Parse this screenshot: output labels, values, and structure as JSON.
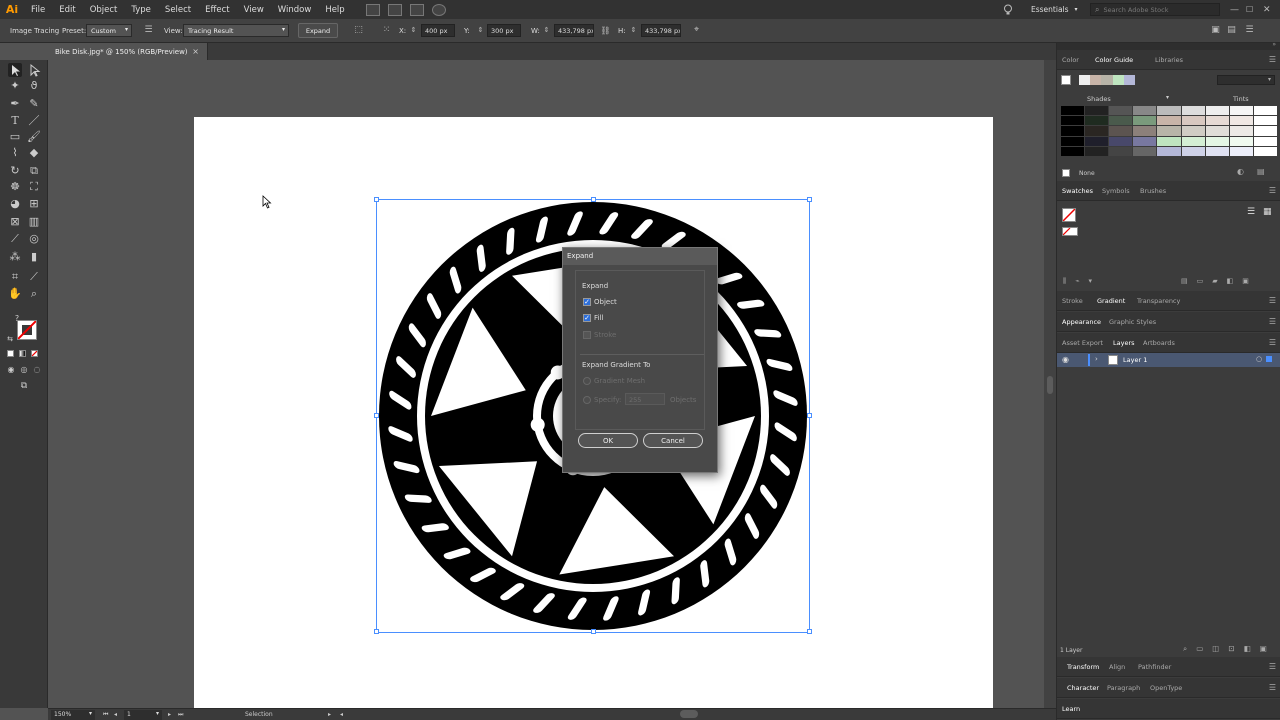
{
  "app": {
    "logo": "Ai",
    "menus": [
      "File",
      "Edit",
      "Object",
      "Type",
      "Select",
      "Effect",
      "View",
      "Window",
      "Help"
    ],
    "workspace": "Essentials",
    "stock_placeholder": "Search Adobe Stock"
  },
  "control_bar": {
    "mode_label": "Image Tracing",
    "preset_label": "Preset:",
    "preset_value": "Custom",
    "view_label": "View:",
    "view_value": "Tracing Result",
    "expand_button": "Expand",
    "x_label": "X:",
    "x_value": "400 px",
    "y_label": "Y:",
    "y_value": "300 px",
    "w_label": "W:",
    "w_value": "433,798 px",
    "h_label": "H:",
    "h_value": "433,798 px"
  },
  "document": {
    "tab_title": "Bike Disk.jpg* @ 150% (RGB/Preview)"
  },
  "status_bar": {
    "zoom": "150%",
    "artboard": "1",
    "tool": "Selection"
  },
  "dialog": {
    "title": "Expand",
    "section_expand": "Expand",
    "object_label": "Object",
    "object_checked": true,
    "fill_label": "Fill",
    "fill_checked": true,
    "stroke_label": "Stroke",
    "stroke_checked": false,
    "section_gradient": "Expand Gradient To",
    "gradient_mesh_label": "Gradient Mesh",
    "specify_label": "Specify:",
    "specify_value": "255",
    "objects_label": "Objects",
    "ok_button": "OK",
    "cancel_button": "Cancel"
  },
  "panels": {
    "color_tabs": [
      "Color",
      "Color Guide",
      "Libraries"
    ],
    "shades_label": "Shades",
    "tints_label": "Tints",
    "none_label": "None",
    "swatch_tabs": [
      "Swatches",
      "Symbols",
      "Brushes"
    ],
    "stroke_tabs": [
      "Stroke",
      "Gradient",
      "Transparency"
    ],
    "appearance_tabs": [
      "Appearance",
      "Graphic Styles"
    ],
    "layer_tabs": [
      "Asset Export",
      "Layers",
      "Artboards"
    ],
    "layer_name": "Layer 1",
    "layer_count": "1 Layer",
    "transform_tabs": [
      "Transform",
      "Align",
      "Pathfinder"
    ],
    "character_tabs": [
      "Character",
      "Paragraph",
      "OpenType"
    ],
    "learn_tab": "Learn"
  },
  "colors": {
    "accent": "#ff9a00",
    "selection": "#4a8fff",
    "dialog_check": "#2d6ed8"
  }
}
